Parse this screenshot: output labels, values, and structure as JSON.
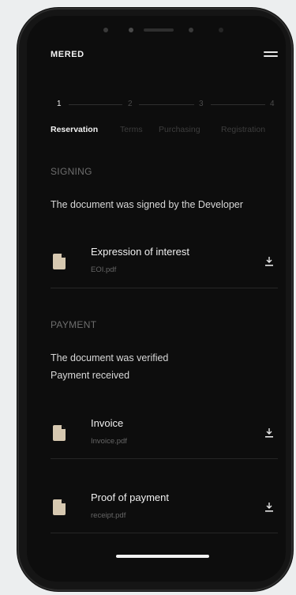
{
  "app": {
    "brand": "MERED"
  },
  "steps": [
    {
      "number": "1",
      "label": "Reservation",
      "active": true
    },
    {
      "number": "2",
      "label": "Terms",
      "active": false
    },
    {
      "number": "3",
      "label": "Purchasing",
      "active": false
    },
    {
      "number": "4",
      "label": "Registration",
      "active": false
    }
  ],
  "signing": {
    "title": "SIGNING",
    "status": "The document was signed by the Developer",
    "documents": [
      {
        "name": "Expression of interest",
        "file": "EOI.pdf"
      }
    ]
  },
  "payment": {
    "title": "PAYMENT",
    "status_lines": [
      "The document was verified",
      "Payment received"
    ],
    "documents": [
      {
        "name": "Invoice",
        "file": "Invoice.pdf"
      },
      {
        "name": "Proof of payment",
        "file": "receipt.pdf"
      }
    ]
  },
  "colors": {
    "background": "#0d0d0d",
    "text": "#f0f0f0",
    "muted": "#6e6e6e",
    "file_icon": "#d6c8b0"
  },
  "icons": [
    "menu-icon",
    "file-icon",
    "download-icon"
  ]
}
